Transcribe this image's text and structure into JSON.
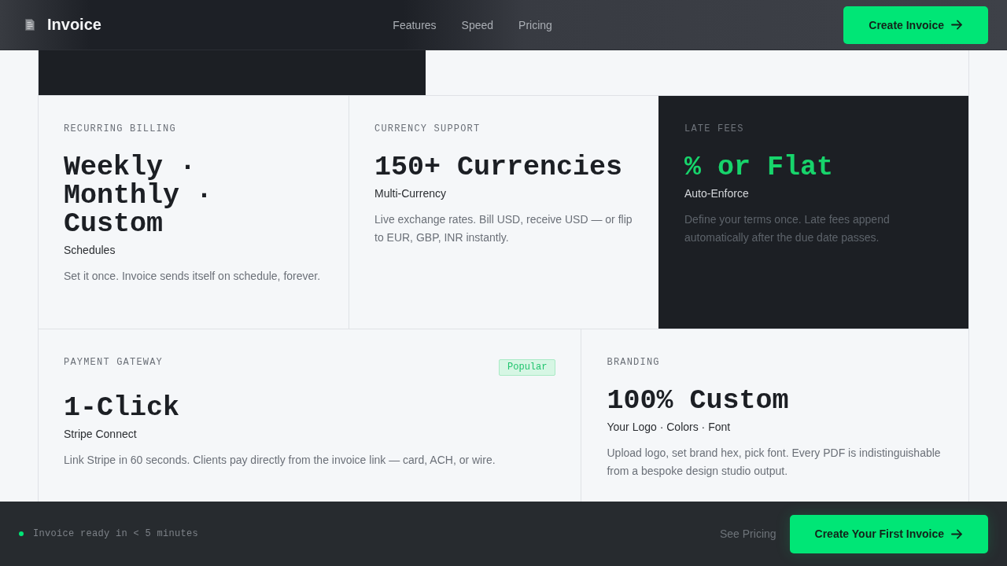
{
  "header": {
    "brand": "Invoice",
    "nav": [
      {
        "label": "Features"
      },
      {
        "label": "Speed"
      },
      {
        "label": "Pricing"
      }
    ],
    "cta": "Create Invoice"
  },
  "feature_rows": [
    {
      "cards": [
        {
          "kind": "light",
          "label": "RECURRING BILLING",
          "title": "Weekly · Monthly · Custom",
          "subtitle": "Schedules",
          "description": "Set it once. Invoice sends itself on schedule, forever."
        },
        {
          "kind": "light",
          "label": "CURRENCY SUPPORT",
          "title": "150+ Currencies",
          "subtitle": "Multi-Currency",
          "description": "Live exchange rates. Bill USD, receive USD — or flip to EUR, GBP, INR instantly."
        },
        {
          "kind": "dark",
          "label": "LATE FEES",
          "title": "% or Flat",
          "subtitle": "Auto-Enforce",
          "description": "Define your terms once. Late fees append automatically after the due date passes."
        }
      ]
    },
    {
      "cards": [
        {
          "kind": "light",
          "label": "PAYMENT GATEWAY",
          "badge": "Popular",
          "title": "1-Click",
          "subtitle": "Stripe Connect",
          "description": "Link Stripe in 60 seconds. Clients pay directly from the invoice link — card, ACH, or wire."
        },
        {
          "kind": "light",
          "label": "BRANDING",
          "title": "100% Custom",
          "subtitle": "Your Logo · Colors · Font",
          "description": "Upload logo, set brand hex, pick font. Every PDF is indistinguishable from a bespoke design studio output."
        }
      ]
    }
  ],
  "footer": {
    "status": "Invoice ready in < 5 minutes",
    "link": "See Pricing",
    "cta": "Create Your First Invoice"
  }
}
